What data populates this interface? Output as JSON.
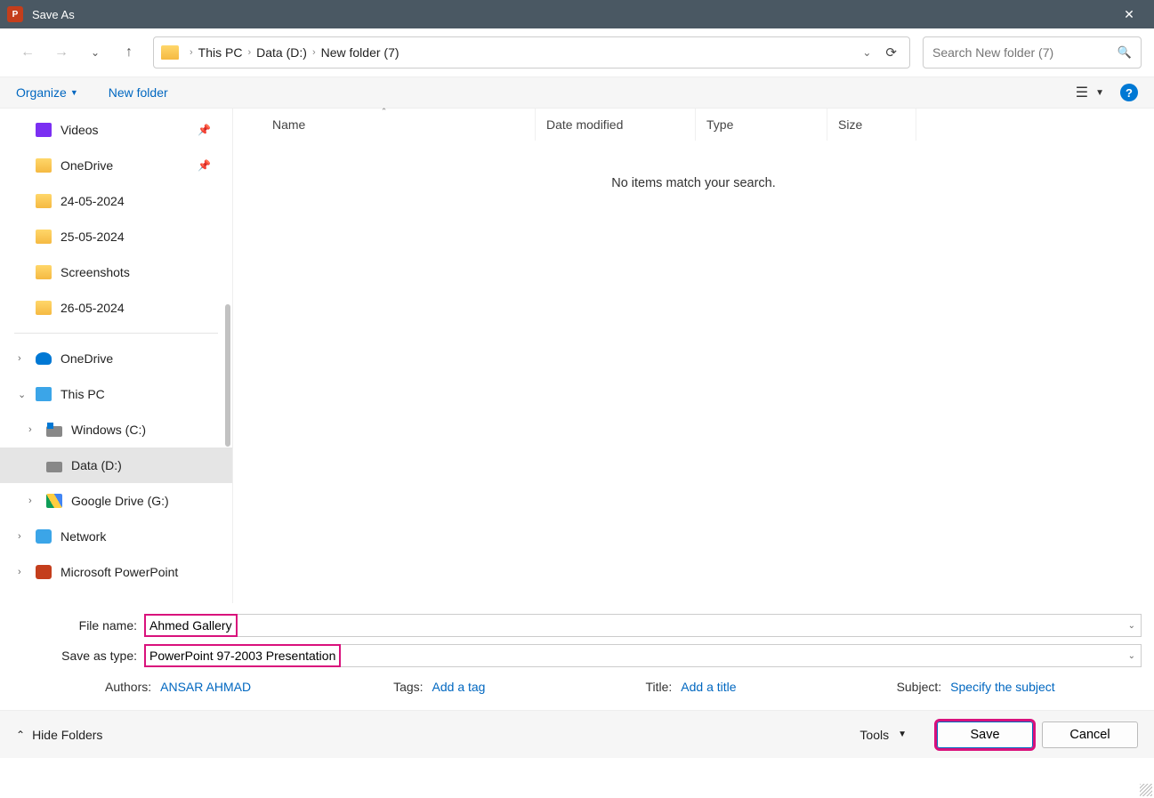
{
  "window": {
    "title": "Save As"
  },
  "breadcrumb": [
    "This PC",
    "Data (D:)",
    "New folder (7)"
  ],
  "search": {
    "placeholder": "Search New folder (7)"
  },
  "toolbar": {
    "organize": "Organize",
    "newfolder": "New folder"
  },
  "sidebar": {
    "quick": [
      {
        "label": "Videos",
        "icon": "video",
        "pin": true
      },
      {
        "label": "OneDrive",
        "icon": "folder",
        "pin": true
      },
      {
        "label": "24-05-2024",
        "icon": "folder"
      },
      {
        "label": "25-05-2024",
        "icon": "folder"
      },
      {
        "label": "Screenshots",
        "icon": "folder"
      },
      {
        "label": "26-05-2024",
        "icon": "folder"
      }
    ],
    "tree": [
      {
        "label": "OneDrive",
        "icon": "cloud",
        "chev": "›"
      },
      {
        "label": "This PC",
        "icon": "pc",
        "chev": "⌄",
        "children": [
          {
            "label": "Windows (C:)",
            "icon": "drive-win",
            "chev": "›"
          },
          {
            "label": "Data (D:)",
            "icon": "drive",
            "selected": true
          },
          {
            "label": "Google Drive (G:)",
            "icon": "gdrive",
            "chev": "›"
          }
        ]
      },
      {
        "label": "Network",
        "icon": "net",
        "chev": "›"
      },
      {
        "label": "Microsoft PowerPoint",
        "icon": "ppt",
        "chev": "›"
      }
    ]
  },
  "listHeader": {
    "name": "Name",
    "date": "Date modified",
    "type": "Type",
    "size": "Size"
  },
  "listEmpty": "No items match your search.",
  "form": {
    "fileNameLabel": "File name:",
    "fileName": "Ahmed Gallery",
    "saveTypeLabel": "Save as type:",
    "saveType": "PowerPoint 97-2003 Presentation",
    "meta": {
      "authorsLabel": "Authors:",
      "authors": "ANSAR AHMAD",
      "tagsLabel": "Tags:",
      "tags": "Add a tag",
      "titleLabel": "Title:",
      "title": "Add a title",
      "subjectLabel": "Subject:",
      "subject": "Specify the subject"
    }
  },
  "footer": {
    "hideFolders": "Hide Folders",
    "tools": "Tools",
    "save": "Save",
    "cancel": "Cancel"
  }
}
